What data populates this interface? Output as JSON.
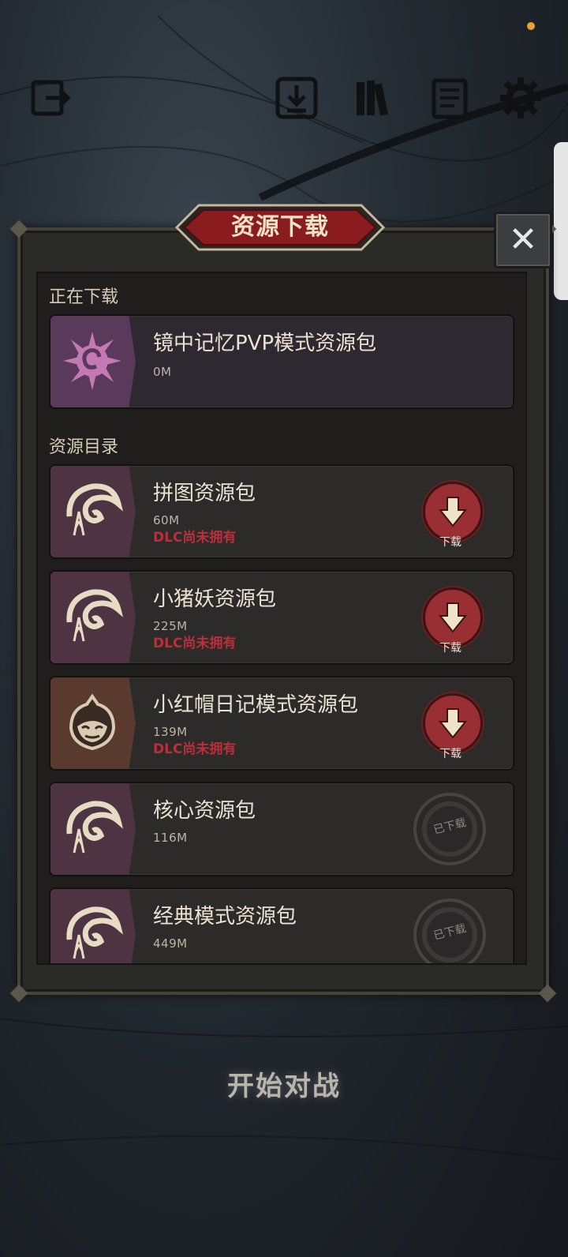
{
  "dialog": {
    "title": "资源下载",
    "close_label": "✕"
  },
  "sections": {
    "downloading_label": "正在下载",
    "catalog_label": "资源目录"
  },
  "downloading": {
    "name": "镜中记忆PVP模式资源包",
    "size": "0M"
  },
  "catalog": [
    {
      "name": "拼图资源包",
      "size": "60M",
      "status": "DLC尚未拥有",
      "action": "下载"
    },
    {
      "name": "小猪妖资源包",
      "size": "225M",
      "status": "DLC尚未拥有",
      "action": "下载"
    },
    {
      "name": "小红帽日记模式资源包",
      "size": "139M",
      "status": "DLC尚未拥有",
      "action": "下载"
    },
    {
      "name": "核心资源包",
      "size": "116M",
      "status": "已下载"
    },
    {
      "name": "经典模式资源包",
      "size": "449M",
      "status": "已下载"
    }
  ],
  "footer": {
    "start_label": "开始对战"
  },
  "colors": {
    "accent_red": "#9a2f33",
    "dlc_red": "#b9303a",
    "status_dot": "#e3a431"
  },
  "icons": [
    "exit-icon",
    "download-icon",
    "books-icon",
    "notes-icon",
    "gear-icon",
    "close-icon"
  ]
}
